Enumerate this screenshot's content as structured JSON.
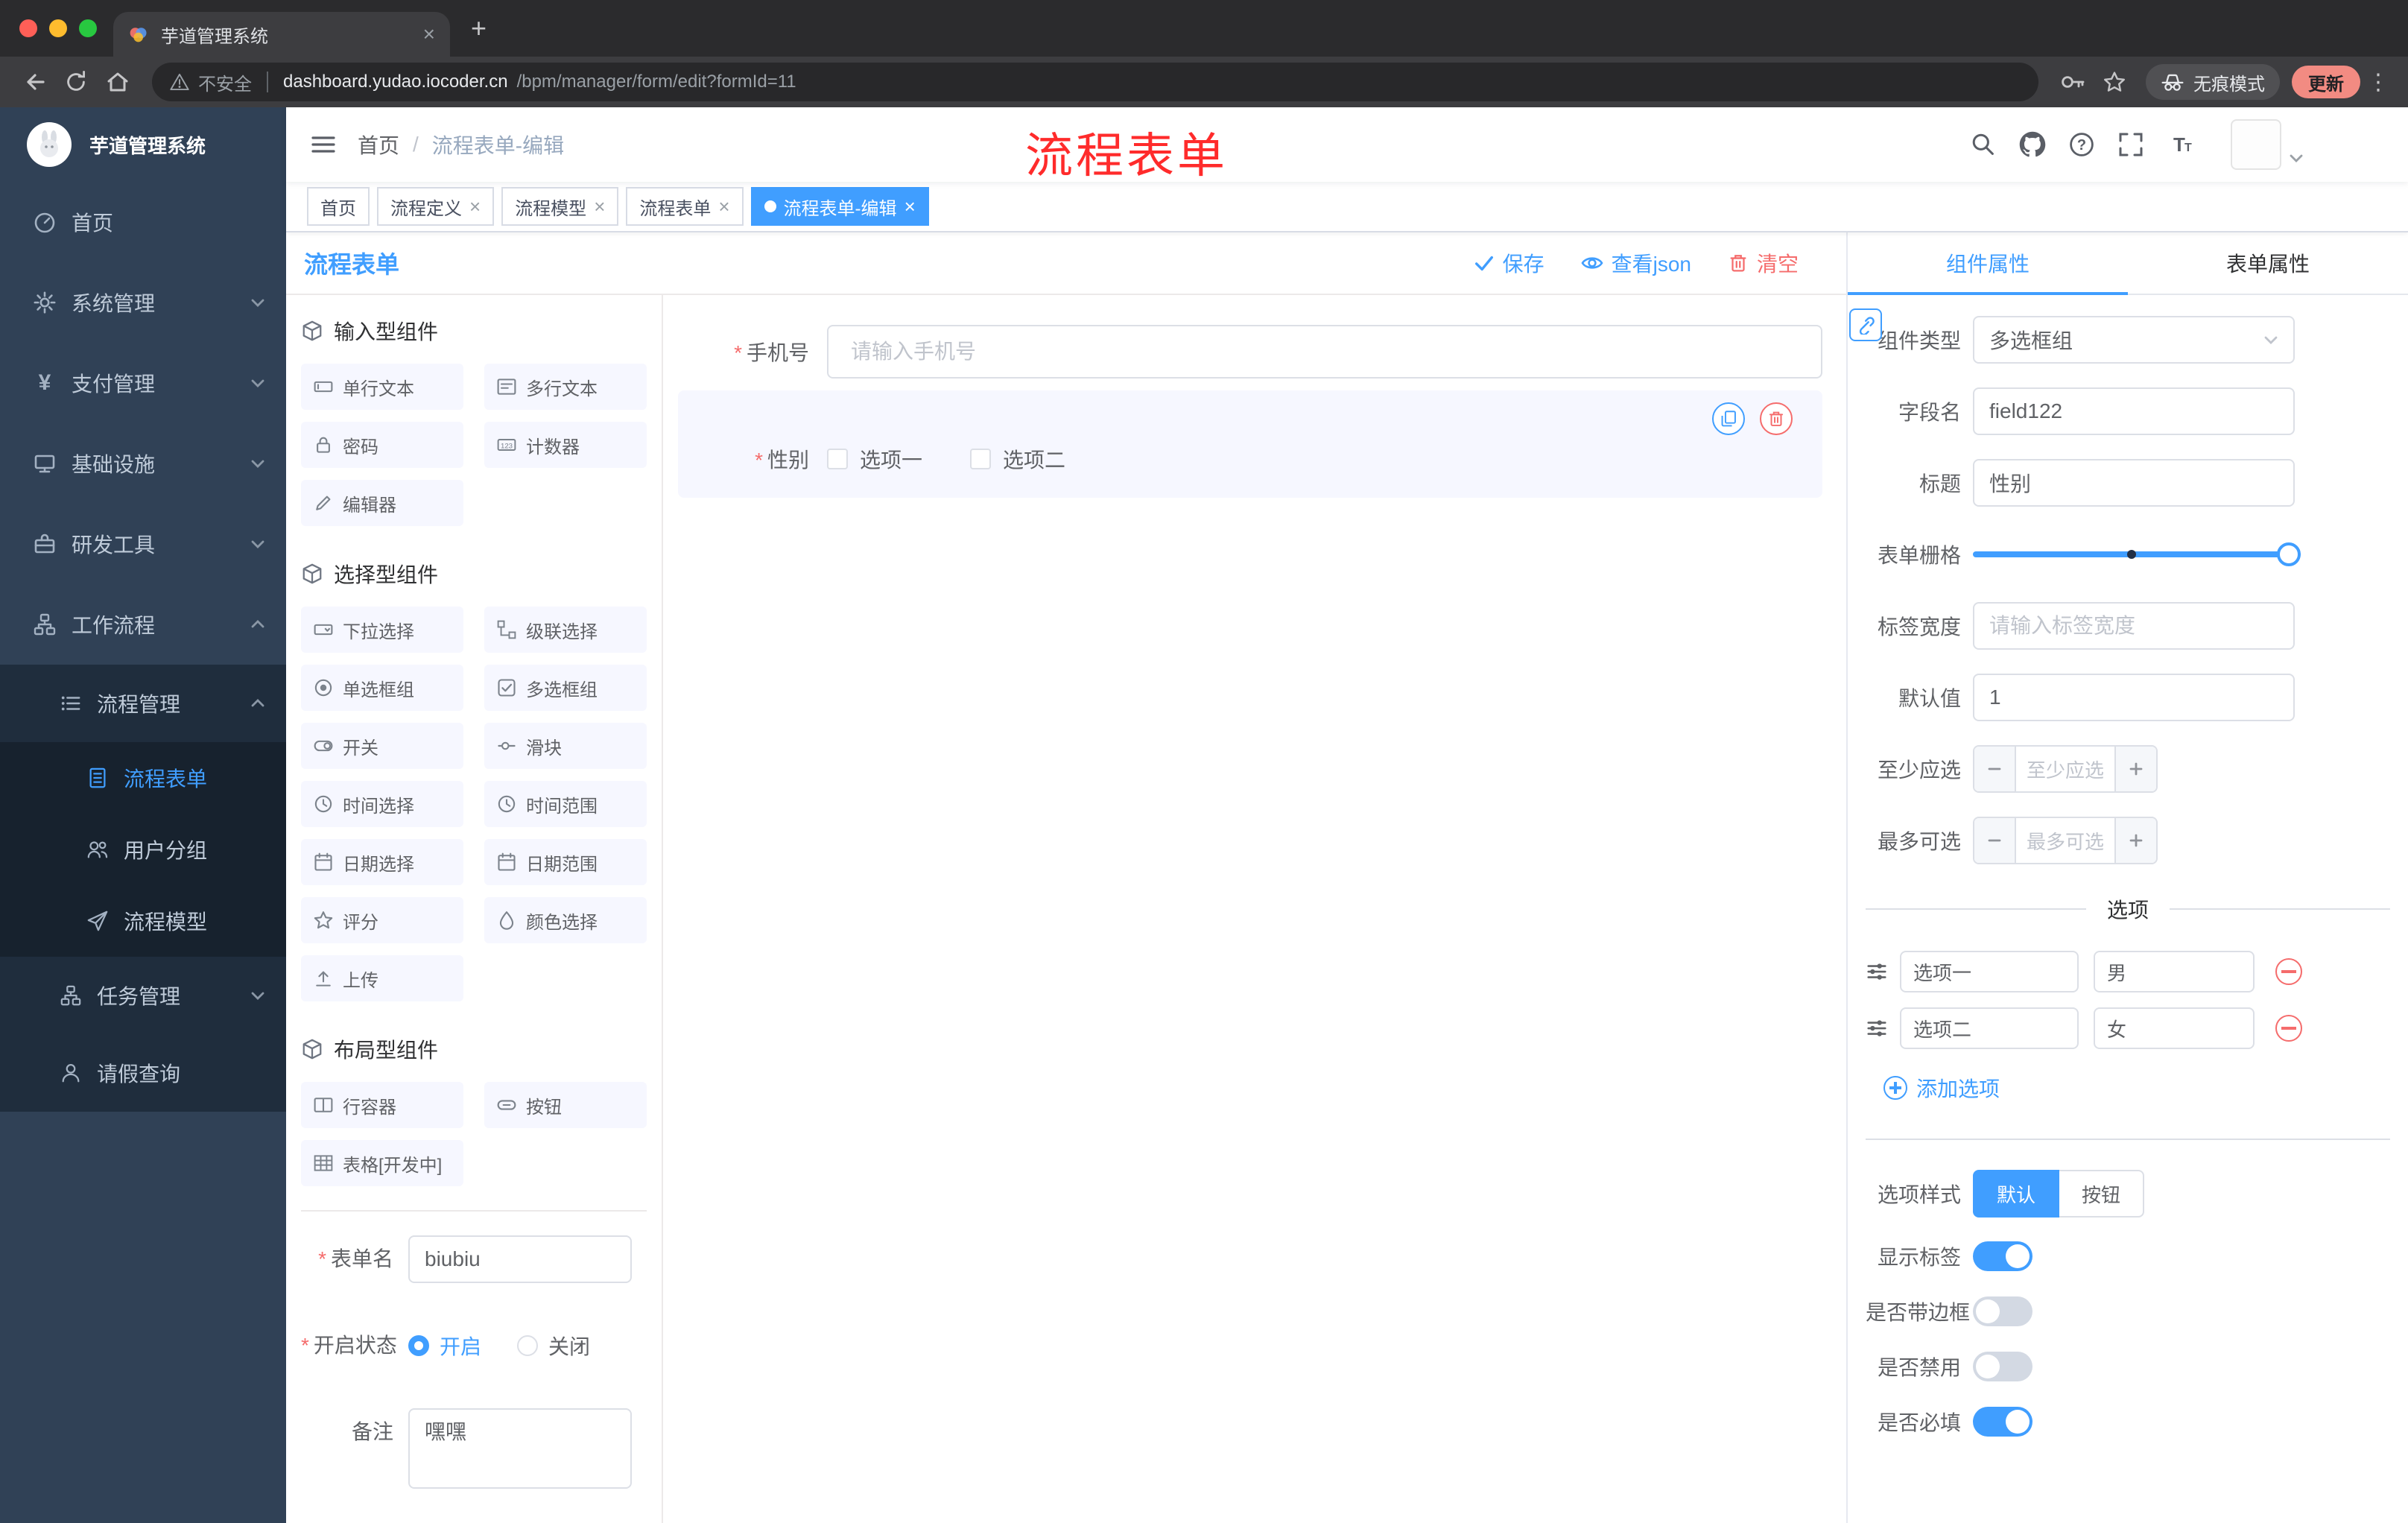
{
  "colors": {
    "primary": "#409eff",
    "danger": "#f56c6c",
    "annotation": "#ff2b2b",
    "update_badge": "#f28b82",
    "sidebar_bg": "#304156"
  },
  "browser": {
    "tab_title": "芋道管理系统",
    "security": "不安全",
    "url_host": "dashboard.yudao.iocoder.cn",
    "url_path": "/bpm/manager/form/edit?formId=11",
    "incognito": "无痕模式",
    "update": "更新"
  },
  "sidebar": {
    "brand": "芋道管理系统",
    "menu": [
      {
        "label": "首页"
      },
      {
        "label": "系统管理"
      },
      {
        "label": "支付管理"
      },
      {
        "label": "基础设施"
      },
      {
        "label": "研发工具"
      },
      {
        "label": "工作流程"
      }
    ],
    "workflow": {
      "process_mgmt": {
        "label": "流程管理"
      },
      "process_children": [
        {
          "label": "流程表单"
        },
        {
          "label": "用户分组"
        },
        {
          "label": "流程模型"
        }
      ],
      "task_mgmt": {
        "label": "任务管理"
      },
      "leave_query": {
        "label": "请假查询"
      }
    }
  },
  "navbar": {
    "breadcrumb_home": "首页",
    "breadcrumb_sep": "/",
    "breadcrumb_current": "流程表单-编辑",
    "annotation": "流程表单"
  },
  "tags": [
    {
      "label": "首页"
    },
    {
      "label": "流程定义"
    },
    {
      "label": "流程模型"
    },
    {
      "label": "流程表单"
    },
    {
      "label": "流程表单-编辑"
    }
  ],
  "designer": {
    "title": "流程表单",
    "save": "保存",
    "view_json": "查看json",
    "clear": "清空"
  },
  "components": {
    "groups": [
      {
        "title": "输入型组件",
        "items": [
          {
            "label": "单行文本"
          },
          {
            "label": "多行文本"
          },
          {
            "label": "密码"
          },
          {
            "label": "计数器"
          },
          {
            "label": "编辑器"
          }
        ]
      },
      {
        "title": "选择型组件",
        "items": [
          {
            "label": "下拉选择"
          },
          {
            "label": "级联选择"
          },
          {
            "label": "单选框组"
          },
          {
            "label": "多选框组"
          },
          {
            "label": "开关"
          },
          {
            "label": "滑块"
          },
          {
            "label": "时间选择"
          },
          {
            "label": "时间范围"
          },
          {
            "label": "日期选择"
          },
          {
            "label": "日期范围"
          },
          {
            "label": "评分"
          },
          {
            "label": "颜色选择"
          },
          {
            "label": "上传"
          }
        ]
      },
      {
        "title": "布局型组件",
        "items": [
          {
            "label": "行容器"
          },
          {
            "label": "按钮"
          },
          {
            "label": "表格[开发中]"
          }
        ]
      }
    ]
  },
  "meta_form": {
    "name_label": "表单名",
    "name_value": "biubiu",
    "status_label": "开启状态",
    "status_on": "开启",
    "status_off": "关闭",
    "remark_label": "备注",
    "remark_value": "嘿嘿"
  },
  "canvas": {
    "phone": {
      "label": "手机号",
      "placeholder": "请输入手机号"
    },
    "gender": {
      "label": "性别",
      "option1": "选项一",
      "option2": "选项二"
    }
  },
  "props": {
    "tab_component": "组件属性",
    "tab_form": "表单属性",
    "type_label": "组件类型",
    "type_value": "多选框组",
    "field_label": "字段名",
    "field_value": "field122",
    "title_label": "标题",
    "title_value": "性别",
    "grid_label": "表单栅格",
    "width_label": "标签宽度",
    "width_placeholder": "请输入标签宽度",
    "default_label": "默认值",
    "default_value": "1",
    "min_label": "至少应选",
    "min_placeholder": "至少应选",
    "max_label": "最多可选",
    "max_placeholder": "最多可选",
    "options_title": "选项",
    "options": [
      {
        "label": "选项一",
        "value": "男"
      },
      {
        "label": "选项二",
        "value": "女"
      }
    ],
    "add_option": "添加选项",
    "style_label": "选项样式",
    "style_default": "默认",
    "style_button": "按钮",
    "switch_show_label": "显示标签",
    "switch_border": "是否带边框",
    "switch_disabled": "是否禁用",
    "switch_required": "是否必填"
  }
}
